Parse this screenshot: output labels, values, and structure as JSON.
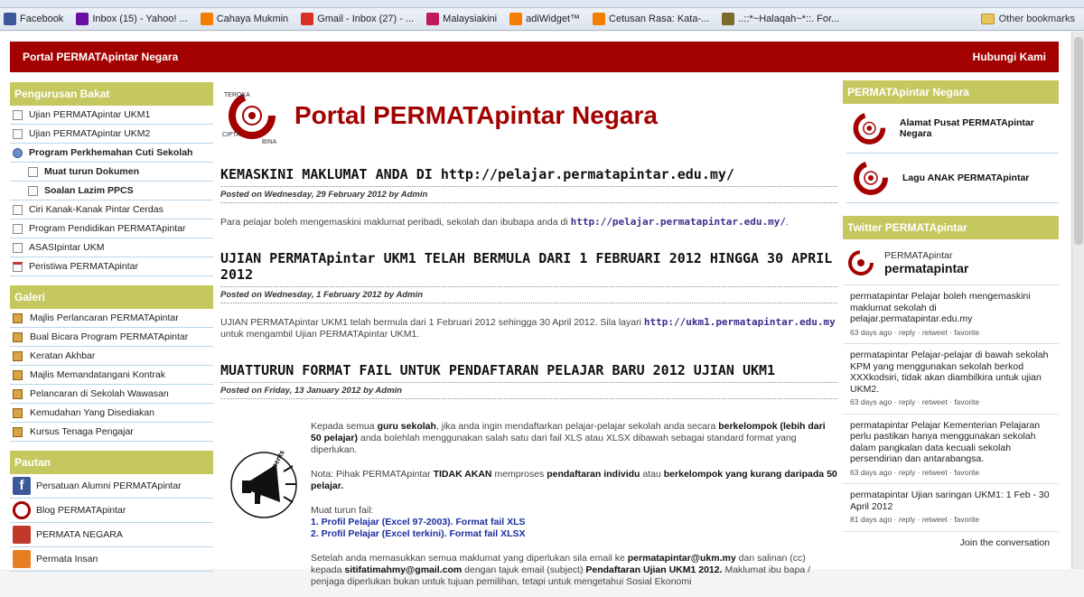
{
  "bookmarks": [
    {
      "label": "Facebook",
      "icon": "facebook-icon",
      "color": "#3b5998"
    },
    {
      "label": "Inbox (15) - Yahoo! ...",
      "icon": "yahoo-icon",
      "color": "#6b0ea3"
    },
    {
      "label": "Cahaya Mukmin",
      "icon": "blogger-icon",
      "color": "#f57d00"
    },
    {
      "label": "Gmail - Inbox (27) - ...",
      "icon": "gmail-icon",
      "color": "#d93025"
    },
    {
      "label": "Malaysiakini",
      "icon": "malaysiakini-icon",
      "color": "#c2185b"
    },
    {
      "label": "adiWidget™",
      "icon": "blogger-icon",
      "color": "#f57d00"
    },
    {
      "label": "Cetusan Rasa: Kata-...",
      "icon": "blogger-icon",
      "color": "#f57d00"
    },
    {
      "label": "..::*~Halaqah~*::. For...",
      "icon": "forum-icon",
      "color": "#7a6b2a"
    }
  ],
  "other_bookmarks": "Other bookmarks",
  "header": {
    "left": "Portal PERMATApintar Negara",
    "right": "Hubungi Kami"
  },
  "site_title": "Portal PERMATApintar Negara",
  "logo_text": {
    "top": "TEROKA",
    "left": "CIPTA",
    "right": "BINA"
  },
  "left_sidebar": {
    "bakat_title": "Pengurusan Bakat",
    "bakat_items": [
      {
        "label": "Ujian PERMATApintar UKM1",
        "type": "page"
      },
      {
        "label": "Ujian PERMATApintar UKM2",
        "type": "page"
      },
      {
        "label": "Program Perkhemahan Cuti Sekolah",
        "type": "group"
      },
      {
        "label": "Muat turun Dokumen",
        "type": "sub"
      },
      {
        "label": "Soalan Lazim PPCS",
        "type": "sub"
      },
      {
        "label": "Ciri Kanak-Kanak Pintar Cerdas",
        "type": "page"
      },
      {
        "label": "Program Pendidikan PERMATApintar",
        "type": "page"
      },
      {
        "label": "ASASIpintar UKM",
        "type": "page"
      },
      {
        "label": "Peristiwa PERMATApintar",
        "type": "calendar"
      }
    ],
    "galeri_title": "Galeri",
    "galeri_items": [
      "Majlis Perlancaran PERMATApintar",
      "Bual Bicara Program PERMATApintar",
      "Keratan Akhbar",
      "Majlis Memandatangani Kontrak",
      "Pelancaran di Sekolah Wawasan",
      "Kemudahan Yang Disediakan",
      "Kursus Tenaga Pengajar"
    ],
    "pautan_title": "Pautan",
    "pautan_items": [
      {
        "label": "Persatuan Alumni PERMATApintar",
        "icon": "facebook-icon"
      },
      {
        "label": "Blog PERMATApintar",
        "icon": "permata-logo-icon"
      },
      {
        "label": "PERMATA NEGARA",
        "icon": "permata-negara-icon"
      },
      {
        "label": "Permata Insan",
        "icon": "permata-insan-icon"
      }
    ]
  },
  "posts": [
    {
      "title": "KEMASKINI MAKLUMAT ANDA DI http://pelajar.permatapintar.edu.my/",
      "meta": "Posted on Wednesday, 29 February 2012 by Admin",
      "body": "Para pelajar boleh mengemaskini maklumat peribadi, sekolah dan ibubapa anda di ",
      "link": "http://pelajar.permatapintar.edu.my/",
      "after": "."
    },
    {
      "title": "UJIAN PERMATApintar UKM1 TELAH BERMULA DARI 1 FEBRUARI 2012 HINGGA 30 APRIL 2012",
      "meta": "Posted on Wednesday, 1 February 2012 by Admin",
      "body": "UJIAN PERMATApintar UKM1 telah bermula dari 1 Februari 2012 sehingga 30 April 2012. Sila layari ",
      "link": "http://ukm1.permatapintar.edu.my",
      "after": " untuk mengambil Ujian PERMATApintar UKM1."
    },
    {
      "title": "MUATTURUN FORMAT FAIL UNTUK PENDAFTARAN PELAJAR BARU 2012 UJIAN UKM1",
      "meta": "Posted on Friday, 13 January 2012 by Admin"
    }
  ],
  "post3": {
    "announcements": "Announcements",
    "p1a": "Kepada semua ",
    "p1b": "guru sekolah",
    "p1c": ", jika anda ingin mendaftarkan pelajar-pelajar sekolah anda secara ",
    "p1d": "berkelompok (lebih dari 50 pelajar)",
    "p1e": " anda bolehlah menggunakan salah satu dari fail XLS atau XLSX dibawah sebagai standard format yang diperlukan.",
    "p2a": "Nota: Pihak PERMATApintar ",
    "p2b": "TIDAK AKAN",
    "p2c": " memproses ",
    "p2d": "pendaftaran individu",
    "p2e": " atau ",
    "p2f": "berkelompok yang kurang daripada 50 pelajar.",
    "p3": "Muat turun fail:",
    "dl1": "1. Profil Pelajar (Excel 97-2003). Format fail XLS",
    "dl2": "2. Profil Pelajar (Excel terkini). Format fail XLSX",
    "p4a": "Setelah anda memasukkan semua maklumat yang diperlukan sila email ke ",
    "p4b": "permatapintar@ukm.my",
    "p4c": " dan salinan (cc) kepada ",
    "p4d": "sitifatimahmy@gmail.com",
    "p4e": " dengan tajuk email (subject) ",
    "p4f": "Pendaftaran Ujian UKM1 2012.",
    "p4g": " Maklumat ibu bapa / penjaga diperlukan bukan untuk tujuan pemilihan, tetapi untuk mengetahui Sosial Ekonomi"
  },
  "right_sidebar": {
    "negara_title": "PERMATApintar Negara",
    "negara_items": [
      "Alamat Pusat PERMATApintar Negara",
      "Lagu ANAK PERMATApintar"
    ],
    "twitter_title": "Twitter PERMATApintar",
    "twitter_name": "PERMATApintar",
    "twitter_handle": "permatapintar",
    "tweets": [
      {
        "text": "permatapintar Pelajar boleh mengemaskini maklumat sekolah di pelajar.permatapintar.edu.my",
        "meta": "63 days ago · reply · retweet · favorite"
      },
      {
        "text": "permatapintar Pelajar-pelajar di bawah sekolah KPM yang menggunakan sekolah berkod XXXkodsiri, tidak akan diambilkira untuk ujian UKM2.",
        "meta": "63 days ago · reply · retweet · favorite"
      },
      {
        "text": "permatapintar Pelajar Kementerian Pelajaran perlu pastikan hanya menggunakan sekolah dalam pangkalan data kecuali sekolah persendirian dan antarabangsa.",
        "meta": "63 days ago · reply · retweet · favorite"
      },
      {
        "text": "permatapintar Ujian saringan UKM1: 1 Feb - 30 April 2012",
        "meta": "81 days ago · reply · retweet · favorite"
      }
    ],
    "join": "Join the conversation"
  }
}
